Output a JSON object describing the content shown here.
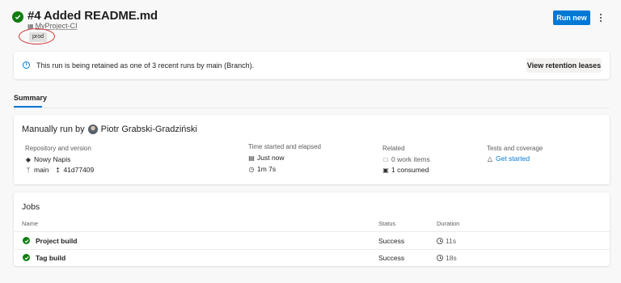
{
  "header": {
    "title": "#4 Added README.md",
    "pipeline_name": "MyProject-CI",
    "tag": "prod",
    "run_new_label": "Run new"
  },
  "banner": {
    "message": "This run is being retained as one of 3 recent runs by main (Branch).",
    "button_label": "View retention leases"
  },
  "tabs": [
    {
      "label": "Summary",
      "selected": true
    }
  ],
  "summary": {
    "title_prefix": "Manually run by",
    "user_name": "Piotr Grabski-Gradziński",
    "repository": {
      "label": "Repository and version",
      "repo_name": "Nowy Napis",
      "branch": "main",
      "commit": "41d77409"
    },
    "time": {
      "label": "Time started and elapsed",
      "started": "Just now",
      "elapsed": "1m 7s"
    },
    "related": {
      "label": "Related",
      "work_items": "0 work items",
      "consumed": "1 consumed"
    },
    "tests": {
      "label": "Tests and coverage",
      "link": "Get started"
    }
  },
  "jobs": {
    "title": "Jobs",
    "columns": {
      "name": "Name",
      "status": "Status",
      "duration": "Duration"
    },
    "rows": [
      {
        "name": "Project build",
        "status": "Success",
        "duration": "11s"
      },
      {
        "name": "Tag build",
        "status": "Success",
        "duration": "18s"
      }
    ]
  },
  "colors": {
    "accent": "#0078d4",
    "success": "#107c10",
    "annotation_ring": "#d13438"
  }
}
